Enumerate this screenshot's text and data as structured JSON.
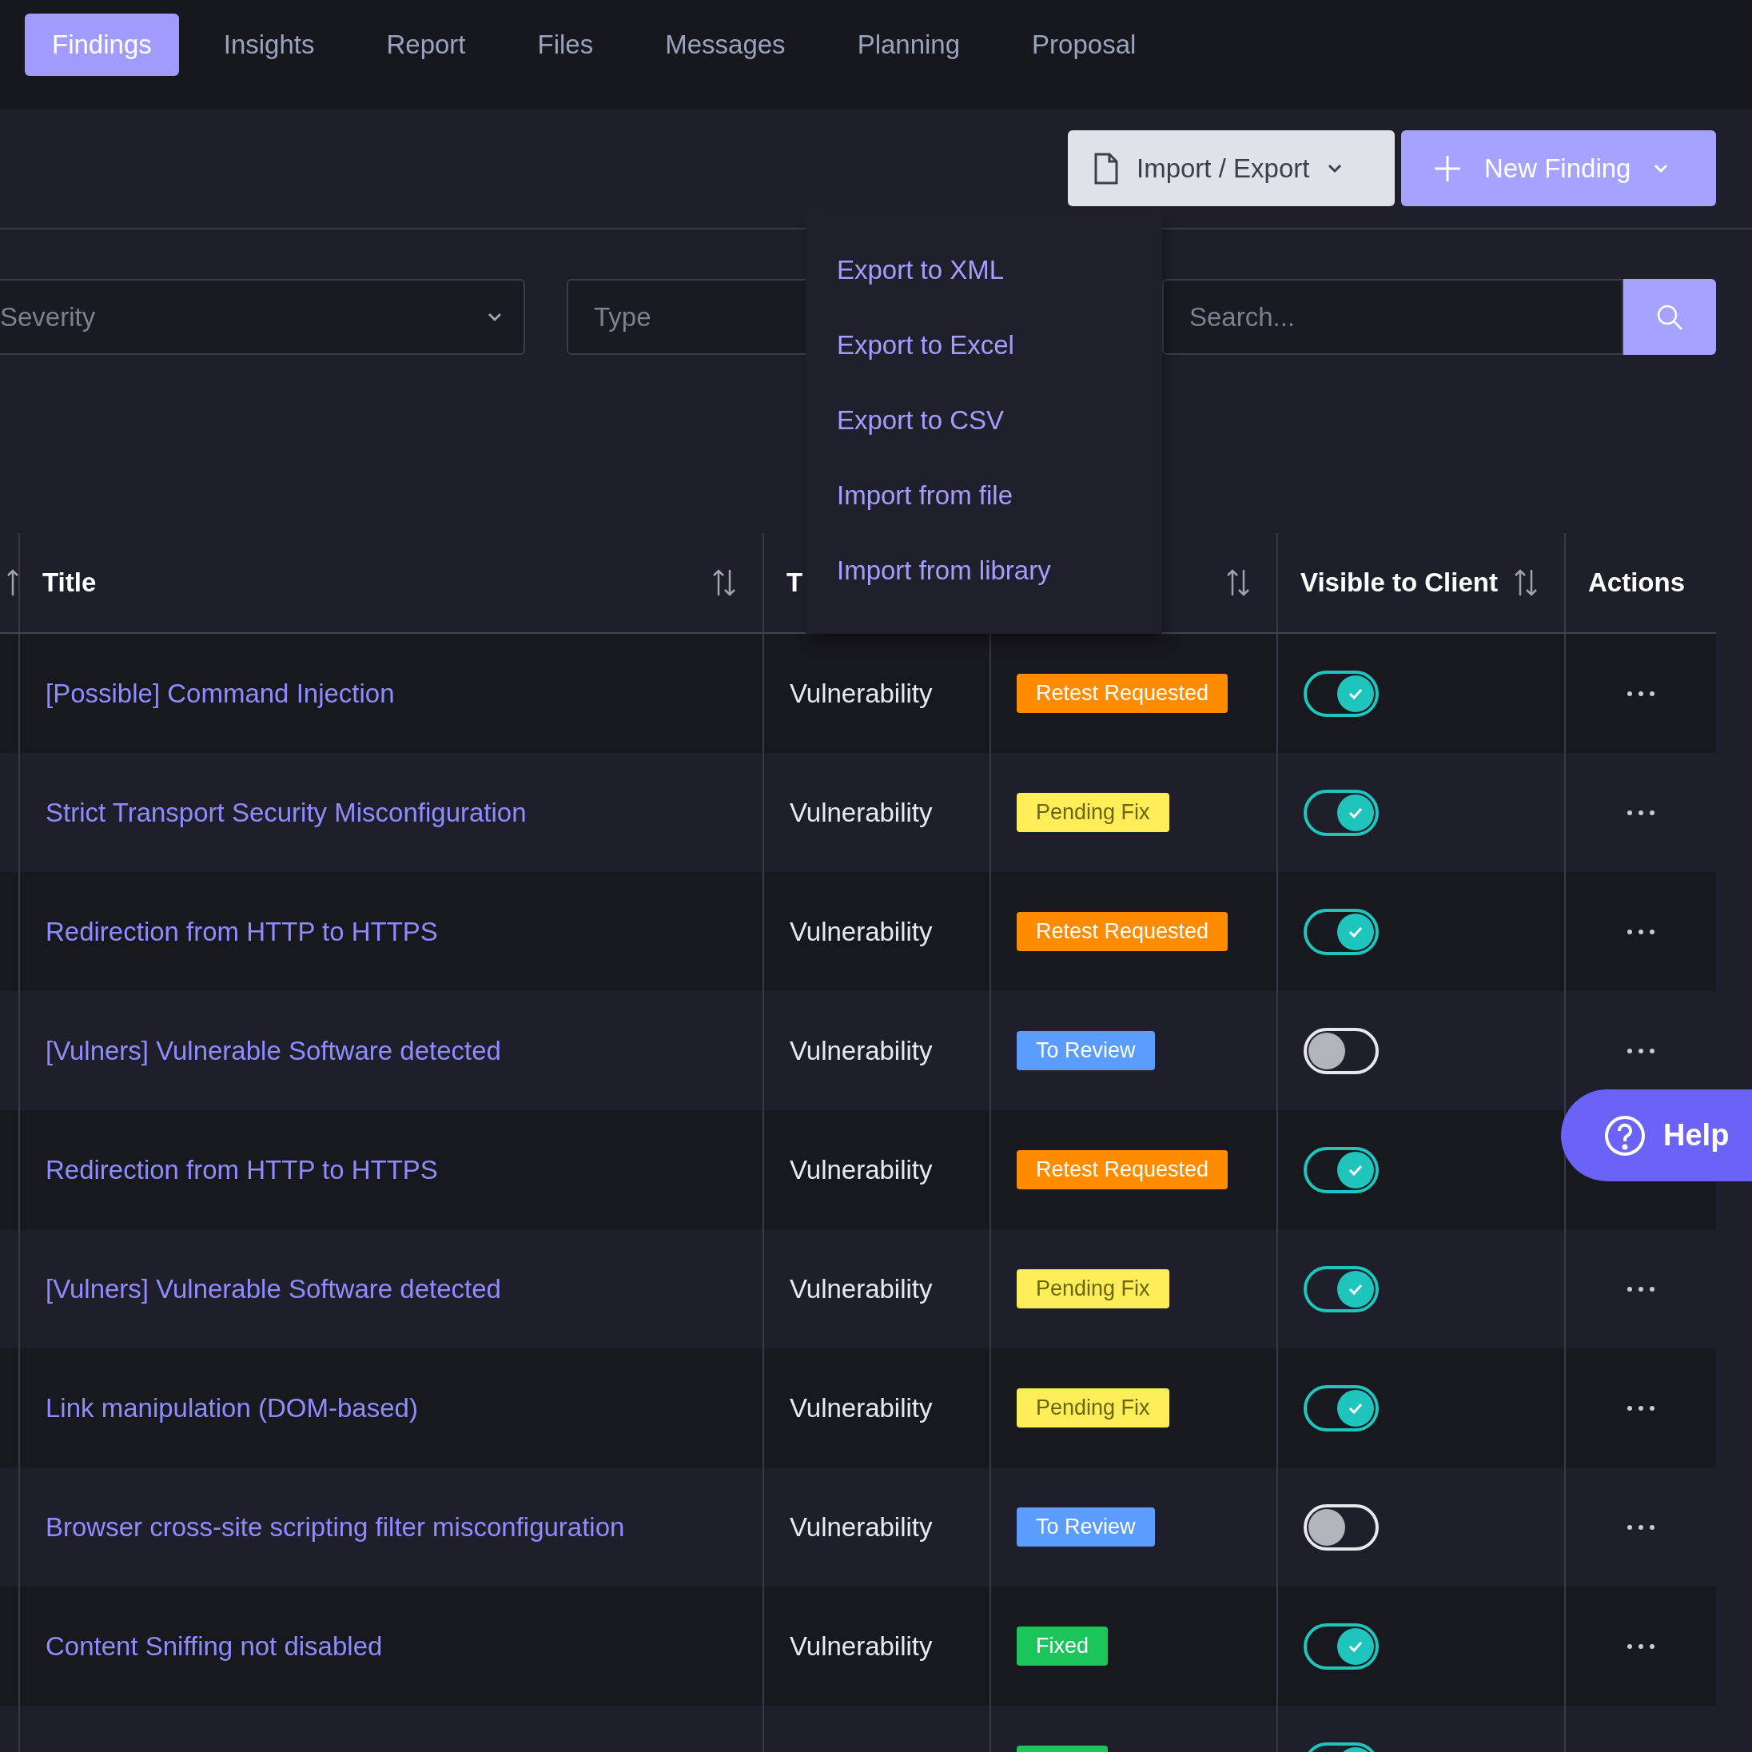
{
  "tabs": [
    {
      "label": "Findings",
      "selected": true
    },
    {
      "label": "Insights",
      "selected": false
    },
    {
      "label": "Report",
      "selected": false
    },
    {
      "label": "Files",
      "selected": false
    },
    {
      "label": "Messages",
      "selected": false
    },
    {
      "label": "Planning",
      "selected": false
    },
    {
      "label": "Proposal",
      "selected": false
    }
  ],
  "toolbar": {
    "import_export": "Import / Export",
    "new_finding": "New Finding"
  },
  "filters": {
    "severity": {
      "placeholder": "Severity"
    },
    "type": {
      "placeholder": "Type"
    },
    "search": {
      "placeholder": "Search..."
    }
  },
  "export_menu": {
    "items": [
      "Export to XML",
      "Export to Excel",
      "Export to CSV",
      "Import from file",
      "Import from library"
    ]
  },
  "table": {
    "columns": [
      {
        "kind": "edge",
        "sortable": true
      },
      {
        "kind": "title",
        "label": "Title",
        "sortable": true
      },
      {
        "kind": "type",
        "label": "T",
        "sortable": false
      },
      {
        "kind": "status",
        "sortable": true
      },
      {
        "kind": "visible",
        "label": "Visible to Client",
        "sortable": true
      },
      {
        "kind": "actions",
        "label": "Actions",
        "sortable": false
      }
    ],
    "rows": [
      {
        "title": "[Possible] Command Injection",
        "type": "Vulnerability",
        "status": {
          "label": "Retest Requested",
          "color": "#ff8c00"
        },
        "visible": true
      },
      {
        "title": "Strict Transport Security Misconfiguration",
        "type": "Vulnerability",
        "status": {
          "label": "Pending Fix",
          "color": "#ffee58"
        },
        "visible": true
      },
      {
        "title": "Redirection from HTTP to HTTPS",
        "type": "Vulnerability",
        "status": {
          "label": "Retest Requested",
          "color": "#ff8c00"
        },
        "visible": true
      },
      {
        "title": "[Vulners] Vulnerable Software detected",
        "type": "Vulnerability",
        "status": {
          "label": "To Review",
          "color": "#5b9dff"
        },
        "visible": false
      },
      {
        "title": "Redirection from HTTP to HTTPS",
        "type": "Vulnerability",
        "status": {
          "label": "Retest Requested",
          "color": "#ff8c00"
        },
        "visible": true
      },
      {
        "title": "[Vulners] Vulnerable Software detected",
        "type": "Vulnerability",
        "status": {
          "label": "Pending Fix",
          "color": "#ffee58"
        },
        "visible": true
      },
      {
        "title": "Link manipulation (DOM-based)",
        "type": "Vulnerability",
        "status": {
          "label": "Pending Fix",
          "color": "#ffee58"
        },
        "visible": true
      },
      {
        "title": "Browser cross-site scripting filter misconfiguration",
        "type": "Vulnerability",
        "status": {
          "label": "To Review",
          "color": "#5b9dff"
        },
        "visible": false
      },
      {
        "title": "Content Sniffing not disabled",
        "type": "Vulnerability",
        "status": {
          "label": "Fixed",
          "color": "#1cc45c"
        },
        "visible": true
      },
      {
        "status": {
          "color": "#1cc45c"
        },
        "visible": true
      }
    ]
  },
  "help": {
    "label": "Help"
  }
}
